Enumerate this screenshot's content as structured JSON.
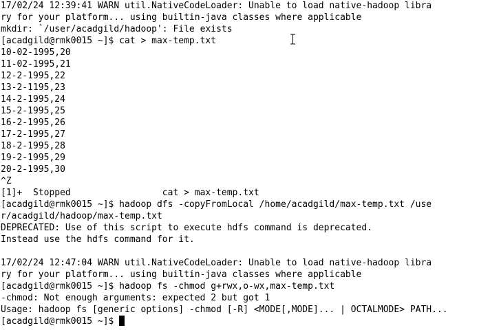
{
  "terminal": {
    "lines": [
      "17/02/24 12:39:41 WARN util.NativeCodeLoader: Unable to load native-hadoop libra",
      "ry for your platform... using builtin-java classes where applicable",
      "mkdir: `/user/acadgild/hadoop': File exists",
      "[acadgild@rmk0015 ~]$ cat > max-temp.txt",
      "10-02-1995,20",
      "11-02-1995,21",
      "12-2-1995,22",
      "13-2-1195,23",
      "14-2-1995,24",
      "15-2-1995,25",
      "16-2-1995,26",
      "17-2-1995,27",
      "18-2-1995,28",
      "19-2-1995,29",
      "20-2-1995,30",
      "^Z",
      "[1]+  Stopped                 cat > max-temp.txt",
      "[acadgild@rmk0015 ~]$ hadoop dfs -copyFromLocal /home/acadgild/max-temp.txt /use",
      "r/acadgild/hadoop/max-temp.txt",
      "DEPRECATED: Use of this script to execute hdfs command is deprecated.",
      "Instead use the hdfs command for it.",
      "",
      "17/02/24 12:47:04 WARN util.NativeCodeLoader: Unable to load native-hadoop libra",
      "ry for your platform... using builtin-java classes where applicable",
      "[acadgild@rmk0015 ~]$ hadoop fs -chmod g+rwx,o-wx,max-temp.txt",
      "-chmod: Not enough arguments: expected 2 but got 1",
      "Usage: hadoop fs [generic options] -chmod [-R] <MODE[,MODE]... | OCTALMODE> PATH..."
    ],
    "prompt": "[acadgild@rmk0015 ~]$ ",
    "colors": {
      "background": "#ffffff",
      "foreground": "#000000"
    }
  }
}
